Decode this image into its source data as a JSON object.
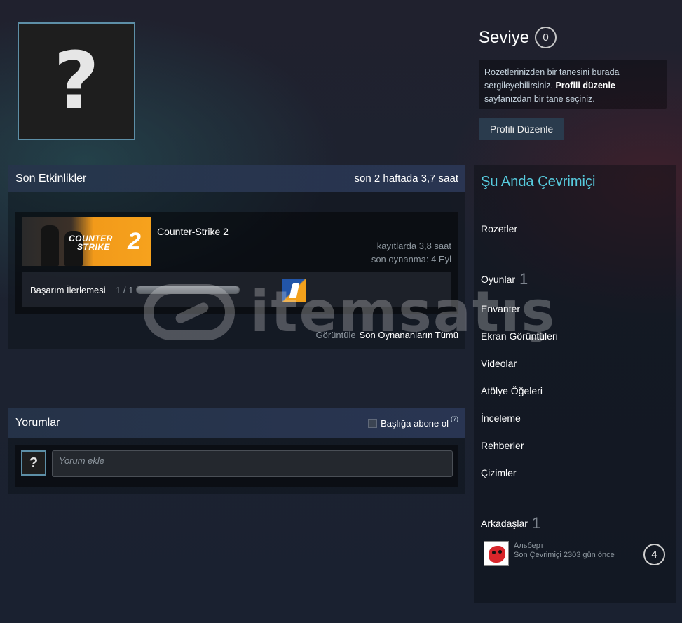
{
  "profile": {
    "avatar_glyph": "?",
    "level_label": "Seviye",
    "level_value": "0",
    "badge_hint": {
      "text_before": "Rozetlerinizden bir tanesini burada sergileyebilirsiniz. ",
      "link": "Profili düzenle",
      "text_after": " sayfanızdan bir tane seçiniz."
    },
    "edit_button": "Profili Düzenle"
  },
  "recent_activity": {
    "title": "Son Etkinlikler",
    "playtime_summary": "son 2 haftada 3,7 saat",
    "game": {
      "capsule_text_line1": "COUNTER",
      "capsule_text_line2": "STRIKE",
      "capsule_number": "2",
      "name": "Counter-Strike 2",
      "total_hours": "kayıtlarda 3,8 saat",
      "last_played": "son oynanma: 4 Eyl",
      "achievement_label": "Başarım İlerlemesi",
      "achievement_count": "1 / 1",
      "achievement_progress": 1.0
    },
    "view_prefix": "Görüntüle",
    "view_link": "Son Oynananların Tümü"
  },
  "comments": {
    "title": "Yorumlar",
    "subscribe_label": "Başlığa abone ol",
    "help_glyph": "(?)",
    "avatar_glyph": "?",
    "input_placeholder": "Yorum ekle"
  },
  "sidebar": {
    "status": "Şu Anda Çevrimiçi",
    "badges": "Rozetler",
    "games_label": "Oyunlar",
    "games_count": "1",
    "inventory": "Envanter",
    "screenshots": "Ekran Görüntüleri",
    "videos": "Videolar",
    "workshop": "Atölye Öğeleri",
    "reviews": "İnceleme",
    "guides": "Rehberler",
    "artwork": "Çizimler",
    "friends_label": "Arkadaşlar",
    "friends_count": "1",
    "friend": {
      "name": "Альберт",
      "status": "Son Çevrimiçi 2303 gün önce",
      "level": "4"
    }
  },
  "watermark": {
    "text": "itemsatış"
  },
  "colors": {
    "online_accent": "#57cbde",
    "avatar_border": "#5d8fa7",
    "edit_button_bg": "#2a3b4d"
  }
}
